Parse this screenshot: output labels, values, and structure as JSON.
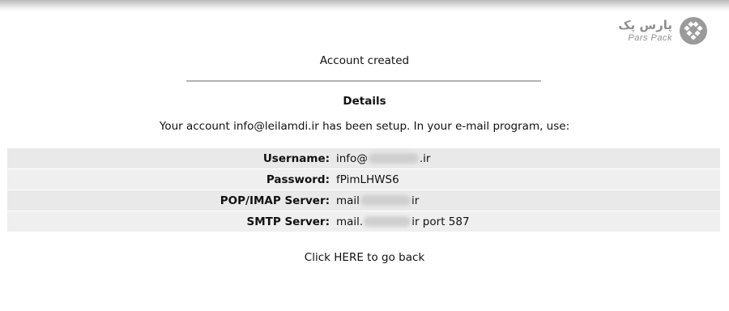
{
  "logo": {
    "fa_text": "پارس پک",
    "en_text": "Pars Pack"
  },
  "status": {
    "title": "Account created"
  },
  "details": {
    "heading": "Details",
    "setup_prefix": "Your account",
    "email": "info@leilamdi.ir",
    "setup_suffix": "has been setup. In your e-mail program, use:"
  },
  "rows": [
    {
      "label": "Username:",
      "value_prefix": "info@",
      "value_suffix": ".ir"
    },
    {
      "label": "Password:",
      "value": "fPimLHWS6"
    },
    {
      "label": "POP/IMAP Server:",
      "value_prefix": "mail",
      "value_suffix": "ir"
    },
    {
      "label": "SMTP Server:",
      "value_prefix": "mail.",
      "value_suffix": "ir port 587"
    }
  ],
  "footer": {
    "prefix": "Click",
    "link": "HERE",
    "suffix": "to go back"
  },
  "colors": {
    "row_bg": "#e9e9e9",
    "divider": "#b3b3b3",
    "logo": "#8f8f8f"
  }
}
